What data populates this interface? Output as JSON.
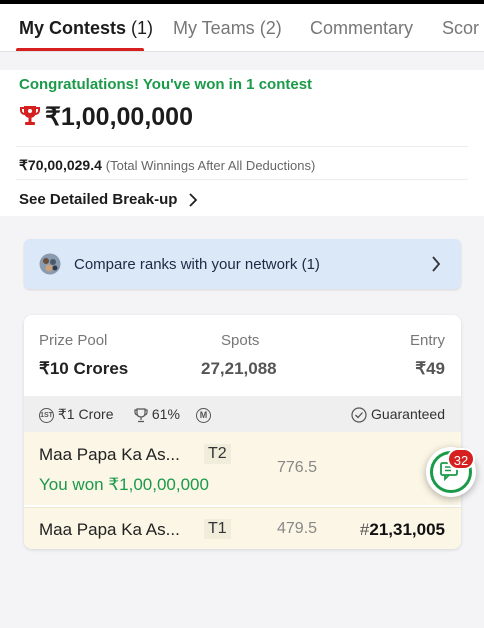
{
  "tabs": [
    {
      "label": "My Contests",
      "count": "(1)"
    },
    {
      "label": "My Teams",
      "count": "(2)"
    },
    {
      "label": "Commentary",
      "count": ""
    },
    {
      "label": "Scor",
      "count": ""
    }
  ],
  "summary": {
    "congrats": "Congratulations! You've won in 1 contest",
    "total_prize": "₹1,00,00,000",
    "net_amount": "₹70,00,029.4",
    "net_note": "(Total Winnings After All Deductions)",
    "breakup_label": "See Detailed Break-up"
  },
  "compare": {
    "text": "Compare ranks with your network (1)"
  },
  "contest": {
    "prize_pool_label": "Prize Pool",
    "prize_pool": "₹10 Crores",
    "spots_label": "Spots",
    "spots": "27,21,088",
    "entry_label": "Entry",
    "entry": "₹49",
    "first_prize": "₹1 Crore",
    "win_percent": "61%",
    "first_badge": "1ST",
    "multi_badge": "M",
    "guaranteed": "Guaranteed",
    "teams": [
      {
        "name": "Maa Papa Ka As...",
        "tag": "T2",
        "points": "776.5",
        "won": "You won ₹1,00,00,000",
        "rank_prefix": "",
        "rank": ""
      },
      {
        "name": "Maa Papa Ka As...",
        "tag": "T1",
        "points": "479.5",
        "won": "",
        "rank_prefix": "#",
        "rank": "21,31,005"
      }
    ]
  },
  "chat": {
    "badge": "32"
  },
  "colors": {
    "accent_red": "#d61f1f",
    "win_green": "#1b9a4a",
    "compare_bg": "#dbe8f8",
    "row_bg": "#fbf6e5"
  }
}
